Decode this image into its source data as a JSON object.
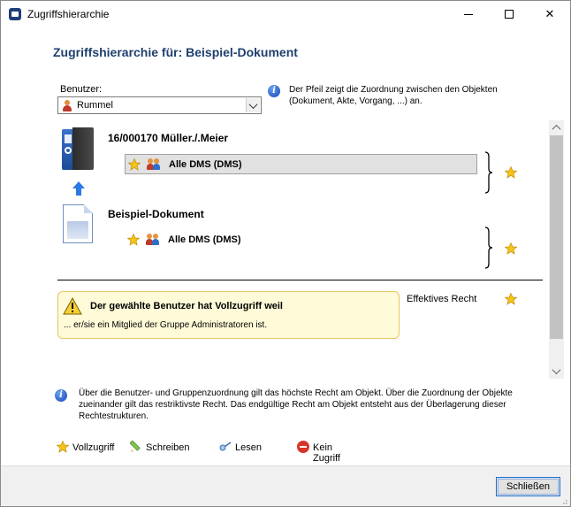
{
  "window": {
    "title": "Zugriffshierarchie",
    "minimize_label": "",
    "maximize_label": "",
    "close_label": "✕"
  },
  "heading": "Zugriffshierarchie für: Beispiel-Dokument",
  "user_selector": {
    "label": "Benutzer:",
    "value": "Rummel"
  },
  "info_top": "Der Pfeil zeigt die Zuordnung zwischen den Objekten (Dokument, Akte, Vorgang, ...) an.",
  "objects": [
    {
      "title": "16/000170 Müller./.Meier",
      "icon": "binder-icon",
      "rights_row": "Alle DMS (DMS)"
    },
    {
      "title": "Beispiel-Dokument",
      "icon": "document-icon",
      "rights_row": "Alle DMS (DMS)"
    }
  ],
  "warning": {
    "title": "Der gewählte Benutzer hat Vollzugriff weil",
    "text": "... er/sie ein Mitglied der Gruppe Administratoren ist."
  },
  "effective_right_label": "Effektives Recht",
  "info_bottom": "Über die Benutzer- und Gruppenzuordnung gilt das höchste Recht am Objekt. Über die Zuordnung der Objekte zueinander gilt das restriktivste Recht. Das endgültige Recht am Objekt entsteht aus der Überlagerung dieser Rechtestrukturen.",
  "legend": {
    "full": "Vollzugriff",
    "write": "Schreiben",
    "read": "Lesen",
    "none": "Kein Zugriff"
  },
  "footer": {
    "close_button": "Schließen"
  },
  "colors": {
    "heading": "#1f3f6e",
    "warning_bg": "#fffbd8",
    "warning_border": "#e4c660",
    "star": "#f5c518",
    "accent": "#1f6fd6"
  }
}
